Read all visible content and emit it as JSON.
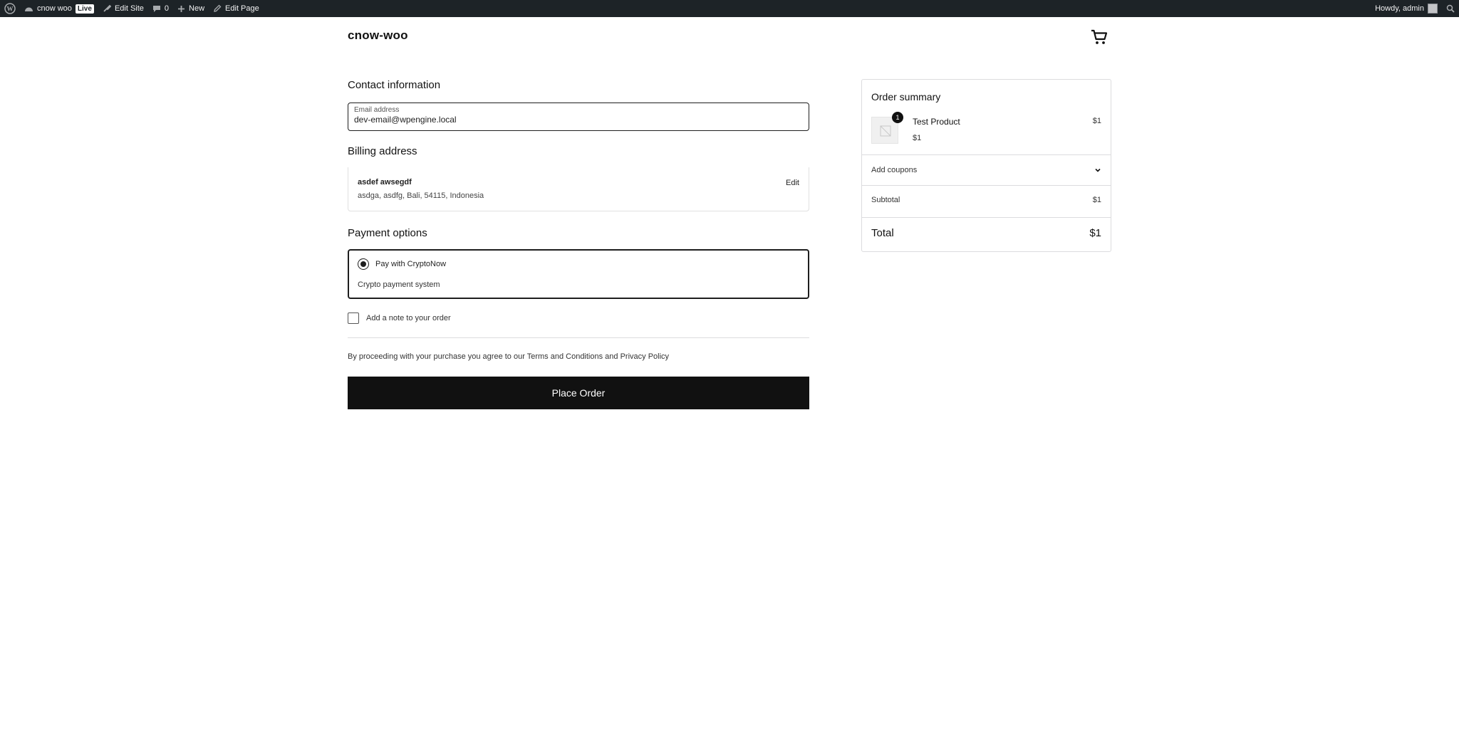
{
  "adminbar": {
    "site_name": "cnow woo",
    "live_badge": "Live",
    "edit_site": "Edit Site",
    "comments_count": "0",
    "new_label": "New",
    "edit_page": "Edit Page",
    "howdy": "Howdy, admin",
    "icons": [
      "wordpress-icon",
      "dashboard-icon",
      "brush-icon",
      "comment-icon",
      "plus-icon",
      "pencil-icon",
      "search-icon"
    ]
  },
  "header": {
    "site_title": "cnow-woo"
  },
  "contact": {
    "title": "Contact information",
    "email_label": "Email address",
    "email_value": "dev-email@wpengine.local"
  },
  "billing": {
    "title": "Billing address",
    "name": "asdef awsegdf",
    "address": "asdga, asdfg, Bali, 54115, Indonesia",
    "edit_label": "Edit"
  },
  "payment": {
    "title": "Payment options",
    "method_label": "Pay with CryptoNow",
    "method_description": "Crypto payment system"
  },
  "note": {
    "label": "Add a note to your order"
  },
  "terms": {
    "text": "By proceeding with your purchase you agree to our Terms and Conditions and Privacy Policy"
  },
  "place_order": {
    "label": "Place Order"
  },
  "summary": {
    "title": "Order summary",
    "item": {
      "quantity": "1",
      "name": "Test Product",
      "line_total": "$1",
      "unit_price": "$1"
    },
    "coupons_label": "Add coupons",
    "subtotal_label": "Subtotal",
    "subtotal_value": "$1",
    "total_label": "Total",
    "total_value": "$1"
  },
  "colors": {
    "adminbar_bg": "#1d2327",
    "button_bg": "#111111",
    "border": "#1e1e1e"
  }
}
